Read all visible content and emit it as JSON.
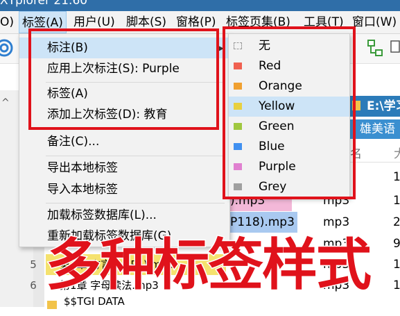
{
  "window": {
    "title": "XYplorer 21.60"
  },
  "menubar": {
    "items": [
      {
        "label": "O)"
      },
      {
        "label": "标签(A)"
      },
      {
        "label": "用户(U)"
      },
      {
        "label": "脚本(S)"
      },
      {
        "label": "窗格(P)"
      },
      {
        "label": "标签页集(B)"
      },
      {
        "label": "工具(T)"
      },
      {
        "label": "窗口(W)"
      }
    ]
  },
  "dropdown": {
    "items": [
      {
        "label": "标注(B)"
      },
      {
        "label": "应用上次标注(S): Purple"
      },
      {
        "label": "标签(A)"
      },
      {
        "label": "添加上次标签(D): 教育"
      },
      {
        "label": "备注(C)..."
      },
      {
        "label": "导出本地标签"
      },
      {
        "label": "导入本地标签"
      },
      {
        "label": "加载标签数据库(L)..."
      },
      {
        "label": "重新加载标签数据库(G)"
      }
    ]
  },
  "submenu": {
    "items": [
      {
        "label": "无",
        "color": ""
      },
      {
        "label": "Red",
        "color": "#f06050"
      },
      {
        "label": "Orange",
        "color": "#f0a030"
      },
      {
        "label": "Yellow",
        "color": "#e8d040"
      },
      {
        "label": "Green",
        "color": "#a0c840"
      },
      {
        "label": "Blue",
        "color": "#4090f0"
      },
      {
        "label": "Purple",
        "color": "#e080d0"
      },
      {
        "label": "Grey",
        "color": "#a0a0a0"
      }
    ]
  },
  "address": {
    "path": "E:\\学习",
    "title": "雄美语"
  },
  "columns": {
    "name": "名"
  },
  "file_rows": [
    {
      "num": "",
      "name": "",
      "ext": "",
      "size": "17"
    },
    {
      "num": "",
      "name": ").mp3",
      "ext": "mp3",
      "size": "16"
    },
    {
      "num": "",
      "name": "P118).mp3",
      "ext": "mp3",
      "size": "2,"
    },
    {
      "num": "",
      "name": "",
      "ext": "mp3",
      "size": "94"
    },
    {
      "num": "5",
      "name": "第2章 方言 P4 P5).mp3",
      "ext": "mp3",
      "size": "1,"
    },
    {
      "num": "6",
      "name": "第1章 字母读法.mp3",
      "ext": "mp3",
      "size": "16"
    },
    {
      "num": "",
      "name": "$$TGI DATA",
      "ext": "",
      "size": ""
    }
  ],
  "caption": {
    "text": "多种标签样式"
  },
  "colors": {
    "annotation_red": "#e0121b",
    "menu_highlight": "#cde4f7"
  }
}
